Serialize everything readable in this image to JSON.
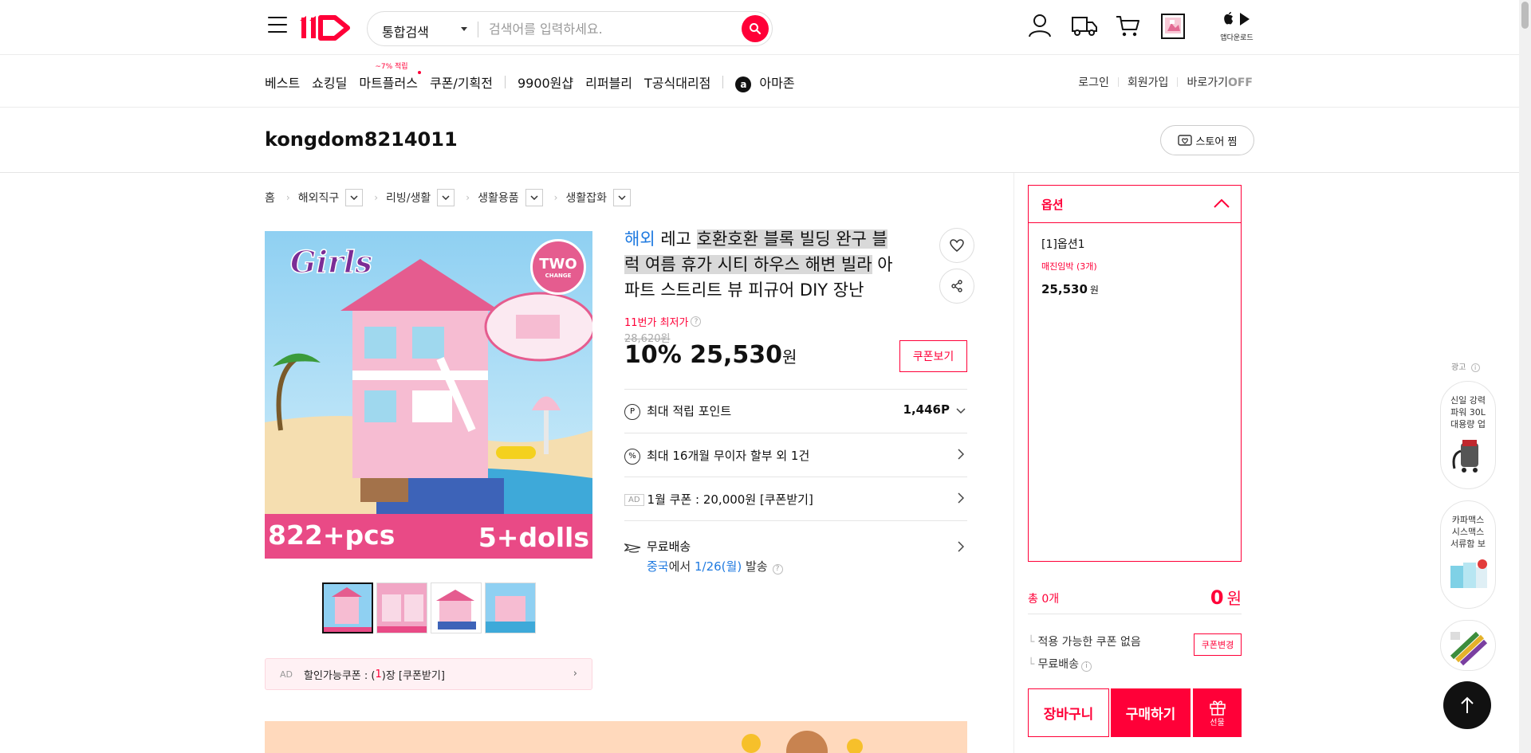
{
  "header": {
    "search_category": "통합검색",
    "search_placeholder": "검색어를 입력하세요.",
    "app_download_label": "앱다운로드"
  },
  "gnb": {
    "items": [
      "베스트",
      "쇼킹딜",
      "마트플러스",
      "쿠폰/기획전",
      "9900원샵",
      "리퍼블리",
      "T공식대리점",
      "아마존"
    ],
    "mart_badge": "~7% 적립",
    "util": {
      "login": "로그인",
      "signup": "회원가입",
      "shortcut": "바로가기",
      "shortcut_state": "OFF"
    }
  },
  "seller": {
    "name": "kongdom8214011",
    "store_zzim": "스토어 찜"
  },
  "breadcrumb": [
    "홈",
    "해외직구",
    "리빙/생활",
    "생활용품",
    "생활잡화"
  ],
  "product": {
    "overseas_tag": "해외",
    "title_line1_plain": "레고 ",
    "title_line1_hl": "호환호환 블록 빌딩 완구 블",
    "title_line2_hl": "럭 여름 휴가 시티 하우스 해변 빌라",
    "title_line2_plain": " 아",
    "title_line3": "파트 스트리트 뷰 피규어 DIY 장난",
    "lowest_label": "11번가 최저가",
    "original_price": "28,620원",
    "discount": "10%",
    "sale_price": "25,530",
    "won": "원",
    "coupon_view": "쿠폰보기",
    "image_text_left": "822+pcs",
    "image_text_right": "5+dolls",
    "image_badge": "TWO",
    "image_badge_small": "CHANGE",
    "image_logo": "Girls"
  },
  "info_rows": {
    "points_label": "최대 적립 포인트",
    "points_value": "1,446P",
    "installment_label": "최대 16개월 무이자 할부 외 1건",
    "ad_tag": "AD",
    "coupon_label": "1월 쿠폰 : 20,000원 [쿠폰받기]",
    "shipping_label": "무료배송",
    "ship_origin": "중국",
    "ship_from_text": "에서 ",
    "ship_date": "1/26(월)",
    "ship_suffix": " 발송"
  },
  "coupon_strip": {
    "ad": "AD",
    "prefix": "할인가능쿠폰 : (",
    "count": "1",
    "suffix": ")장 [쿠폰받기]"
  },
  "option_panel": {
    "title": "옵션",
    "option_name": "[1]옵션1",
    "stock_note": "매진임박 (3개)",
    "option_price": "25,530",
    "won": "원"
  },
  "purchase": {
    "total_label": "총 0개",
    "total_price": "0",
    "won": "원",
    "no_coupon": "적용 가능한 쿠폰 없음",
    "coupon_change": "쿠폰변경",
    "free_shipping": "무료배송",
    "cart_button": "장바구니",
    "buy_button": "구매하기",
    "gift_label": "선물"
  },
  "ad_rail": {
    "label": "광고",
    "cards": [
      {
        "text": "신일 강력 파워 30L 대용량 업"
      },
      {
        "text": "카파맥스 시스맥스 서류함 보"
      }
    ]
  },
  "colors": {
    "accent": "#ff0038",
    "blue": "#1f7ae0"
  }
}
